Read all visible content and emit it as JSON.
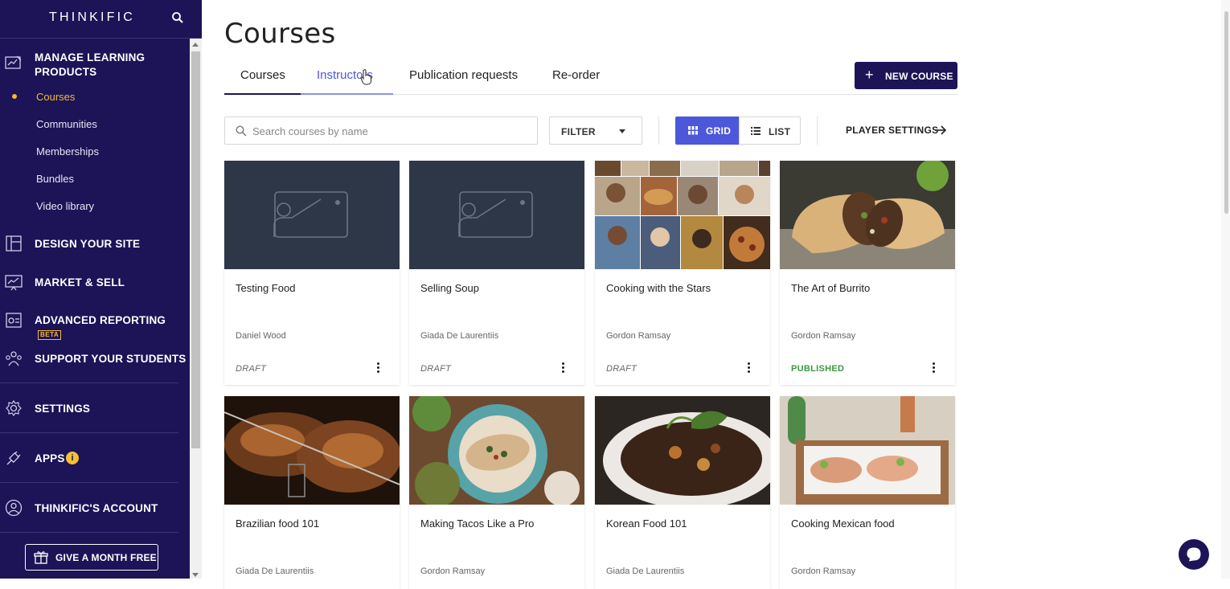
{
  "brand": {
    "logo": "THINKIFIC",
    "accent": "#1c1457",
    "highlight": "#f5b833"
  },
  "sidebar": {
    "sections": [
      {
        "title": "MANAGE LEARNING PRODUCTS",
        "icon": "edit-board-icon",
        "items": [
          {
            "label": "Courses",
            "active": true
          },
          {
            "label": "Communities"
          },
          {
            "label": "Memberships"
          },
          {
            "label": "Bundles"
          },
          {
            "label": "Video library"
          }
        ]
      },
      {
        "title": "DESIGN YOUR SITE",
        "icon": "layout-icon"
      },
      {
        "title": "MARKET & SELL",
        "icon": "chart-board-icon"
      },
      {
        "title": "ADVANCED REPORTING",
        "badge": "BETA",
        "icon": "report-icon"
      },
      {
        "title": "SUPPORT YOUR STUDENTS",
        "icon": "users-icon"
      },
      {
        "title": "SETTINGS",
        "icon": "gear-icon"
      },
      {
        "title": "APPS",
        "badge": "i",
        "icon": "plug-icon"
      },
      {
        "title": "THINKIFIC'S ACCOUNT",
        "icon": "account-icon"
      }
    ],
    "give_button": "GIVE A MONTH FREE"
  },
  "main": {
    "title": "Courses",
    "tabs": [
      {
        "label": "Courses",
        "active": true
      },
      {
        "label": "Instructors",
        "hover": true
      },
      {
        "label": "Publication requests"
      },
      {
        "label": "Re-order"
      }
    ],
    "new_course": "NEW COURSE",
    "search_placeholder": "Search courses by name",
    "filter_label": "FILTER",
    "view": {
      "grid": "GRID",
      "list": "LIST",
      "selected": "grid"
    },
    "player_settings": "PLAYER SETTINGS"
  },
  "courses": [
    {
      "title": "Testing Food",
      "author": "Daniel Wood",
      "status": "DRAFT",
      "thumb": "placeholder"
    },
    {
      "title": "Selling Soup",
      "author": "Giada De Laurentiis",
      "status": "DRAFT",
      "thumb": "placeholder"
    },
    {
      "title": "Cooking with the Stars",
      "author": "Gordon Ramsay",
      "status": "DRAFT",
      "thumb": "collage"
    },
    {
      "title": "The Art of Burrito",
      "author": "Gordon Ramsay",
      "status": "PUBLISHED",
      "thumb": "burrito"
    },
    {
      "title": "Brazilian food 101",
      "author": "Giada De Laurentiis",
      "status": "",
      "thumb": "grill"
    },
    {
      "title": "Making Tacos Like a Pro",
      "author": "Gordon Ramsay",
      "status": "",
      "thumb": "tacos"
    },
    {
      "title": "Korean Food 101",
      "author": "Giada De Laurentiis",
      "status": "",
      "thumb": "korean"
    },
    {
      "title": "Cooking Mexican food",
      "author": "Gordon Ramsay",
      "status": "",
      "thumb": "mexican"
    }
  ]
}
